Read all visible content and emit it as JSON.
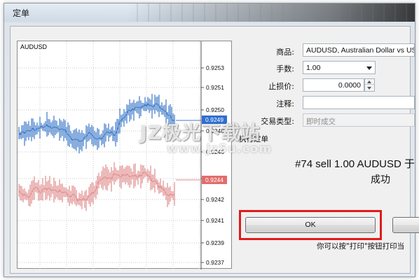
{
  "window": {
    "title": "定单"
  },
  "chart": {
    "symbol": "AUDUSD",
    "price_ticks": [
      "0.9253",
      "0.9251",
      "0.9250",
      "0.9248",
      "0.9246",
      "0.9244",
      "0.9242",
      "0.9241",
      "0.9239",
      "0.9237"
    ],
    "ask_tag": "0.9249",
    "bid_tag": "0.9244",
    "colors": {
      "ask": "#3b78c7",
      "bid": "#e08c8c",
      "ask_tag_bg": "#2f6fd1",
      "bid_tag_bg": "#e26d6d",
      "grid": "#c8c8c8"
    }
  },
  "form": {
    "symbol_label": "商品:",
    "symbol_value": "AUDUSD, Australian Dollar vs US",
    "volume_label": "手数:",
    "volume_value": "1.00",
    "stoploss_label": "止损价:",
    "stoploss_value": "0.0000",
    "comment_label": "注释:",
    "comment_value": "",
    "type_label": "交易类型:",
    "type_value": "即时成交"
  },
  "result": {
    "section_title": "执行定单",
    "message_line1": "#74 sell 1.00 AUDUSD 于",
    "message_line2": "成功",
    "ok_label": "OK",
    "print_label": "",
    "hint": "你可以按\"打印\"按钮打印当"
  },
  "watermark": {
    "main": "JZ极光下载站",
    "url": "www.jz5u.com"
  }
}
